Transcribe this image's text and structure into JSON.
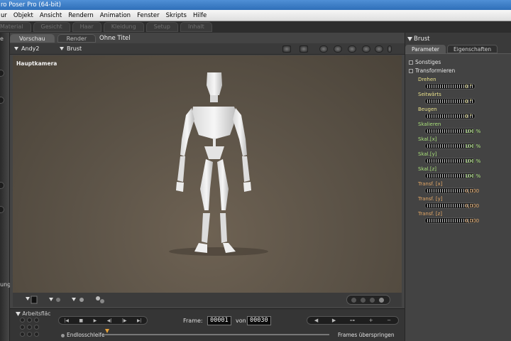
{
  "app": {
    "title": "ro Poser Pro  (64-bit)"
  },
  "menu": [
    "ur",
    "Objekt",
    "Ansicht",
    "Rendern",
    "Animation",
    "Fenster",
    "Skripts",
    "Hilfe"
  ],
  "rooms": [
    "Material",
    "Gesicht",
    "Haar",
    "Kleidung",
    "Setup",
    "Inhalt"
  ],
  "left": {
    "frag_top": "e",
    "frag_bottom": "ung"
  },
  "document": {
    "tabs": [
      {
        "label": "Vorschau"
      },
      {
        "label": "Render"
      }
    ],
    "title": "Ohne Titel",
    "figure_dropdown": "Andy2",
    "actor_dropdown": "Brust",
    "camera_label": "Hauptkamera"
  },
  "panel": {
    "title": "Brust",
    "tabs": [
      {
        "label": "Parameter"
      },
      {
        "label": "Eigenschaften"
      }
    ],
    "groups": [
      {
        "label": "Sonstiges"
      },
      {
        "label": "Transformieren"
      }
    ],
    "params": [
      {
        "label": "Drehen",
        "value": "0 °",
        "color": "#e8e08a"
      },
      {
        "label": "Seitwärts",
        "value": "0 °",
        "color": "#e8e08a"
      },
      {
        "label": "Beugen",
        "value": "0 °",
        "color": "#e8e08a"
      },
      {
        "label": "Skalieren",
        "value": "100 %",
        "color": "#a9e07a"
      },
      {
        "label": "Skal.[x]",
        "value": "100 %",
        "color": "#a9e07a"
      },
      {
        "label": "Skal.[y]",
        "value": "100 %",
        "color": "#a9e07a"
      },
      {
        "label": "Skal.[z]",
        "value": "100 %",
        "color": "#a9e07a"
      },
      {
        "label": "Transf. [x]",
        "value": "0,000",
        "color": "#e3a766"
      },
      {
        "label": "Transf. [y]",
        "value": "0,000",
        "color": "#e3a766"
      },
      {
        "label": "Transf. [z]",
        "value": "0,000",
        "color": "#e3a766"
      }
    ]
  },
  "animation": {
    "workspace_label": "Arbeitsfläc",
    "frame_label": "Frame:",
    "current_frame": "00001",
    "of_label": "von",
    "total_frames": "00030",
    "loop_label": "Endlosschleife",
    "skip_label": "Frames überspringen"
  },
  "colors": {
    "titlebar": "#3f7fc8",
    "viewport": "#5d5448",
    "param_rotate": "#e8e08a",
    "param_scale": "#a9e07a",
    "param_translate": "#e3a766",
    "scrub_marker": "#e7a23a"
  }
}
